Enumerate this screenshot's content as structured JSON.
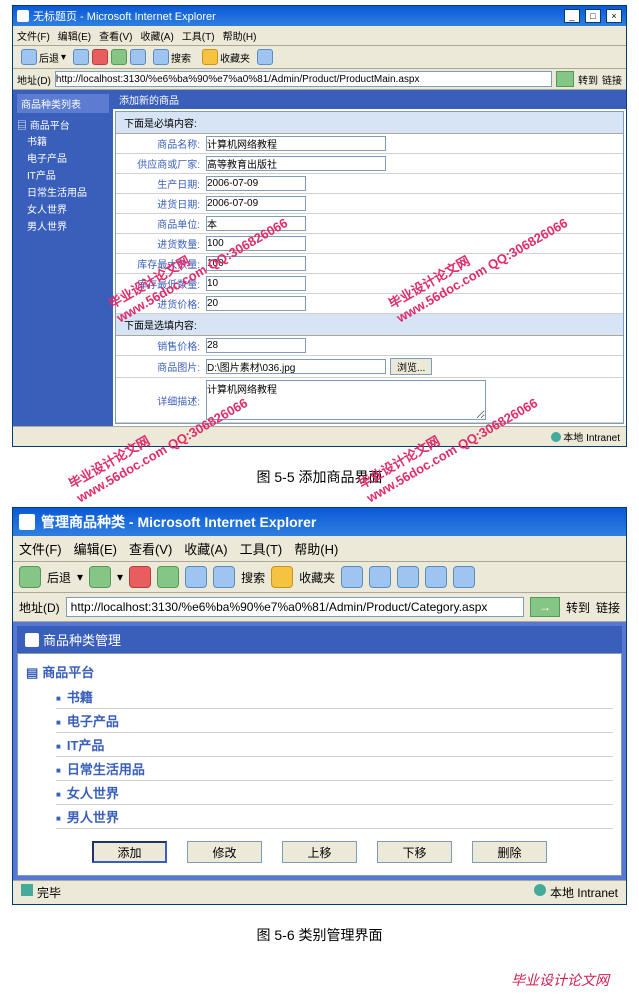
{
  "watermark": {
    "site": "www.56doc.com",
    "brand": "毕业设计论文网",
    "qq": "QQ:306826066"
  },
  "win1": {
    "title": "无标题页 - Microsoft Internet Explorer",
    "menu": [
      "文件(F)",
      "编辑(E)",
      "查看(V)",
      "收藏(A)",
      "工具(T)",
      "帮助(H)"
    ],
    "toolbar": {
      "back": "后退",
      "search": "搜索",
      "fav": "收藏夹"
    },
    "addr_label": "地址(D)",
    "addr": "http://localhost:3130/%e6%ba%90%e7%a0%81/Admin/Product/ProductMain.aspx",
    "go": "转到",
    "links": "链接",
    "sidebar": {
      "title1": "商品种类列表",
      "root": "商品平台",
      "items": [
        "书籍",
        "电子产品",
        "IT产品",
        "日常生活用品",
        "女人世界",
        "男人世界"
      ]
    },
    "main": {
      "header": "添加新的商品",
      "section1": "下面是必填内容:",
      "section2": "下面是选填内容:",
      "fields": {
        "name": {
          "label": "商品名称:",
          "value": "计算机网络教程"
        },
        "supplier": {
          "label": "供应商或厂家:",
          "value": "高等教育出版社"
        },
        "mfg_date": {
          "label": "生产日期:",
          "value": "2006-07-09"
        },
        "in_date": {
          "label": "进货日期:",
          "value": "2006-07-09"
        },
        "unit": {
          "label": "商品单位:",
          "value": "本"
        },
        "qty": {
          "label": "进货数量:",
          "value": "100"
        },
        "stock_max": {
          "label": "库存最大数量:",
          "value": "100"
        },
        "stock_min": {
          "label": "库存最低数量:",
          "value": "10"
        },
        "in_price": {
          "label": "进货价格:",
          "value": "20"
        },
        "sell_price": {
          "label": "销售价格:",
          "value": "28"
        },
        "pic": {
          "label": "商品图片:",
          "value": "D:\\图片素材\\036.jpg",
          "browse": "浏览..."
        },
        "desc": {
          "label": "详细描述:",
          "value": "计算机网络教程"
        }
      }
    },
    "status_zone": "本地 Intranet"
  },
  "caption1": "图 5-5  添加商品界面",
  "win2": {
    "title": "管理商品种类 - Microsoft Internet Explorer",
    "menu": [
      "文件(F)",
      "编辑(E)",
      "查看(V)",
      "收藏(A)",
      "工具(T)",
      "帮助(H)"
    ],
    "toolbar": {
      "back": "后退",
      "search": "搜索",
      "fav": "收藏夹"
    },
    "addr_label": "地址(D)",
    "addr": "http://localhost:3130/%e6%ba%90%e7%a0%81/Admin/Product/Category.aspx",
    "go": "转到",
    "links": "链接",
    "panel_title": "商品种类管理",
    "root": "商品平台",
    "cats": [
      "书籍",
      "电子产品",
      "IT产品",
      "日常生活用品",
      "女人世界",
      "男人世界"
    ],
    "buttons": [
      "添加",
      "修改",
      "上移",
      "下移",
      "删除"
    ],
    "status_done": "完毕",
    "status_zone": "本地 Intranet"
  },
  "caption2": "图 5-6 类别管理界面",
  "footer": "毕业设计论文网"
}
